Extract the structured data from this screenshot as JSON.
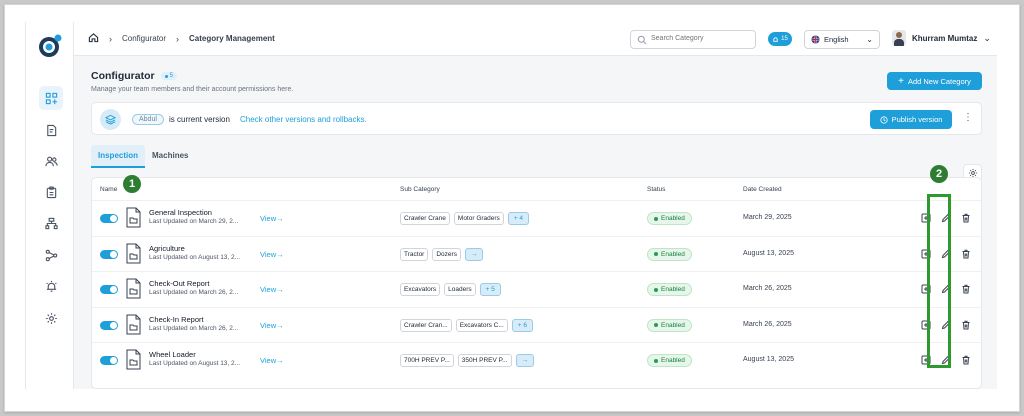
{
  "breadcrumb": {
    "home_icon": "home-icon",
    "items": [
      "Configurator",
      "Category Management"
    ]
  },
  "search": {
    "placeholder": "Search Category"
  },
  "notifications": {
    "count": "15"
  },
  "language": {
    "label": "English",
    "flag": "uk-flag-icon"
  },
  "user": {
    "name": "Khurram Mumtaz"
  },
  "sidebar": {
    "items": [
      "configurator-icon",
      "report-icon",
      "users-icon",
      "clipboard-icon",
      "hierarchy-icon",
      "workflow-icon",
      "alarm-icon",
      "settings-icon"
    ],
    "active_index": 0
  },
  "page": {
    "title": "Configurator",
    "count": "5",
    "subtitle": "Manage your team members and their account permissions here.",
    "add_button": "Add New Category"
  },
  "version": {
    "user_chip": "Abdul",
    "text": "is current version",
    "link": "Check other versions and rollbacks.",
    "publish_button": "Publish version"
  },
  "tabs": [
    "Inspection",
    "Machines"
  ],
  "table": {
    "headers": {
      "name": "Name",
      "sub_category": "Sub Category",
      "status": "Status",
      "date_created": "Date Created"
    },
    "view_label": "View",
    "rows": [
      {
        "name": "General Inspection",
        "updated": "Last Updated on March 29, 2...",
        "chips": [
          "Crawler Crane",
          "Motor Graders"
        ],
        "more": "+ 4",
        "status": "Enabled",
        "date": "March 29, 2025"
      },
      {
        "name": "Agriculture",
        "updated": "Last Updated on August 13, 2...",
        "chips": [
          "Tractor",
          "Dozers"
        ],
        "more": "→",
        "status": "Enabled",
        "date": "August 13, 2025"
      },
      {
        "name": "Check-Out Report",
        "updated": "Last Updated on March 26, 2...",
        "chips": [
          "Excavators",
          "Loaders"
        ],
        "more": "+ 5",
        "status": "Enabled",
        "date": "March 26, 2025"
      },
      {
        "name": "Check-In Report",
        "updated": "Last Updated on March 26, 2...",
        "chips": [
          "Crawler Cran...",
          "Excavators C..."
        ],
        "more": "+ 6",
        "status": "Enabled",
        "date": "March 26, 2025"
      },
      {
        "name": "Wheel Loader",
        "updated": "Last Updated on August 13, 2...",
        "chips": [
          "700H PREV P...",
          "350H PREV P..."
        ],
        "more": "→",
        "status": "Enabled",
        "date": "August 13, 2025"
      }
    ]
  },
  "annotations": {
    "marker_1": "1",
    "marker_2": "2"
  },
  "colors": {
    "accent": "#1f9fd9",
    "enabled": "#15803d",
    "annotation": "#2e9a2e"
  }
}
